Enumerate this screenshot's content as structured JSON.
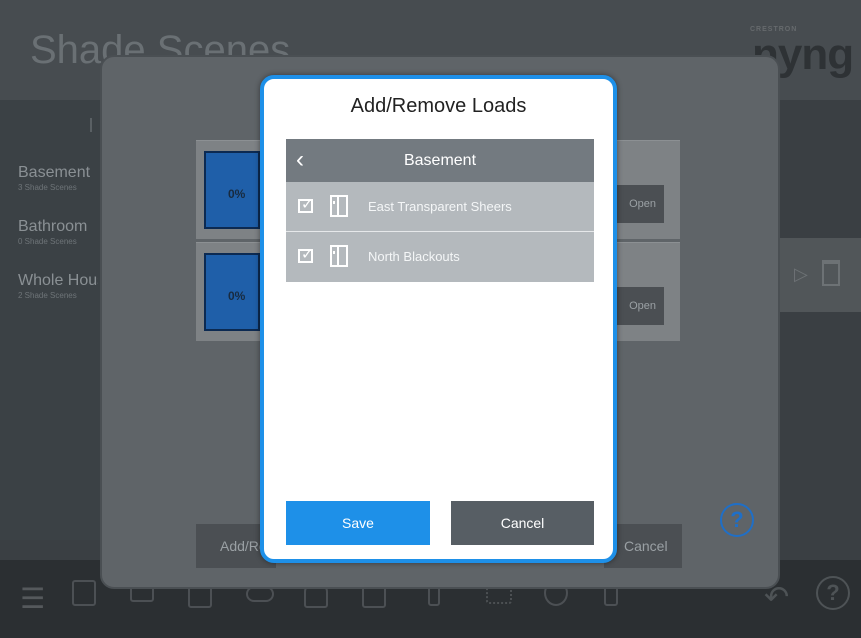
{
  "background_app": {
    "title": "Shade Scenes",
    "brand_small": "CRESTRON",
    "brand_logo": "nyng",
    "rooms": [
      {
        "name": "Basement",
        "subtitle": "3 Shade Scenes"
      },
      {
        "name": "Bathroom",
        "subtitle": "0 Shade Scenes"
      },
      {
        "name": "Whole House",
        "subtitle": "2 Shade Scenes"
      }
    ],
    "scenes": [
      {
        "percent": "0%",
        "open_label": "Open"
      },
      {
        "percent": "0%",
        "open_label": "Open"
      }
    ],
    "add_remove_label": "Add/Remove",
    "cancel_label": "Cancel",
    "help_symbol": "?"
  },
  "modal": {
    "title": "Add/Remove Loads",
    "list_header": "Basement",
    "back_symbol": "‹",
    "loads": [
      {
        "label": "East Transparent Sheers",
        "checked": true
      },
      {
        "label": "North Blackouts",
        "checked": true
      }
    ],
    "save_label": "Save",
    "cancel_label": "Cancel"
  },
  "colors": {
    "accent": "#1e90e8",
    "header_gray": "#737a80",
    "row_gray": "#b4b9bd",
    "cancel_gray": "#575e64"
  }
}
